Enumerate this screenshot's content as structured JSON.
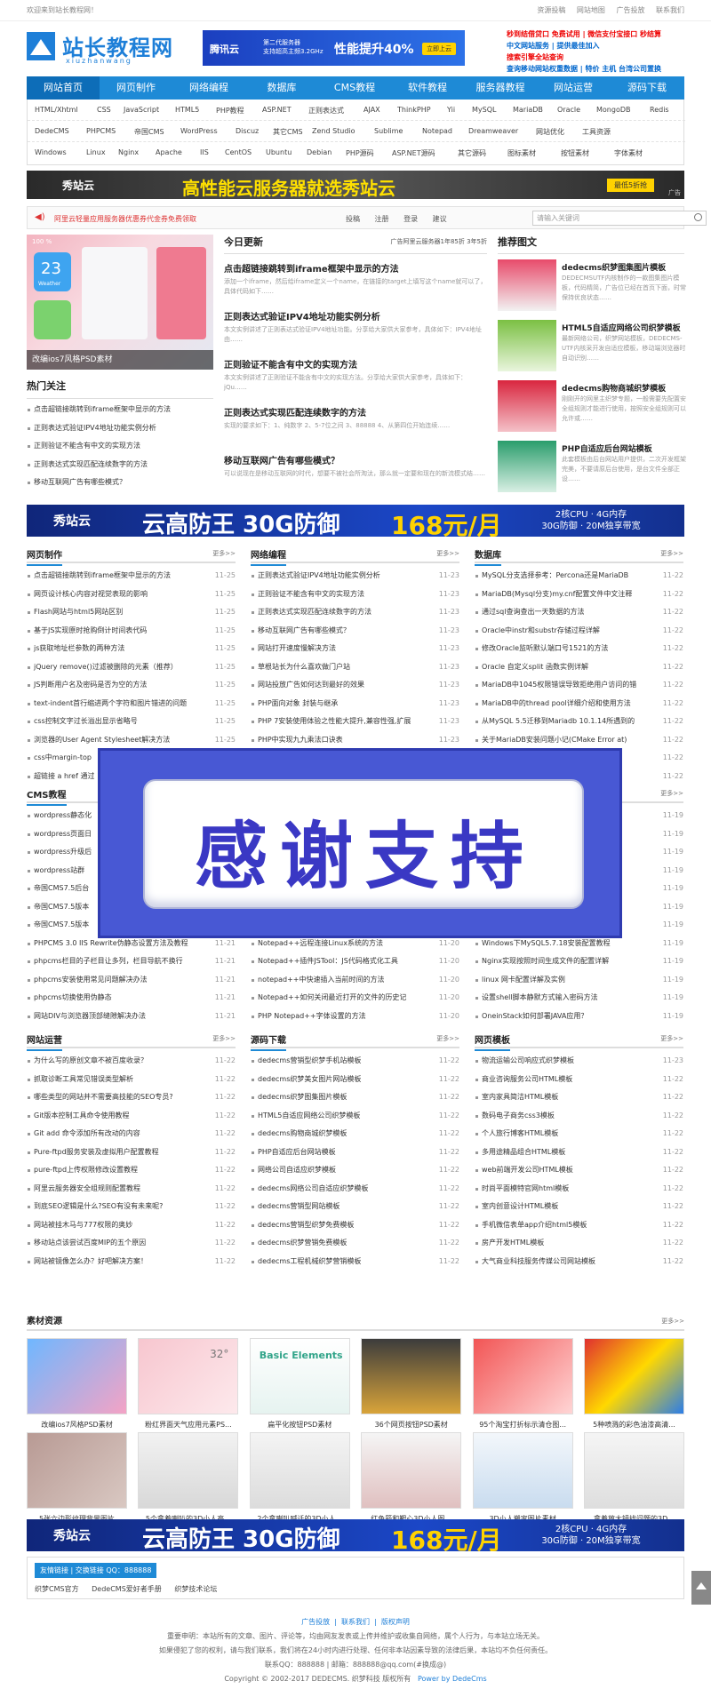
{
  "topbar": {
    "welcome": "欢迎来到站长教程网！",
    "links": [
      "资源投稿",
      "网站地图",
      "广告投放",
      "联系我们"
    ]
  },
  "logo": {
    "title": "站长教程网",
    "subtitle": "xiuzhanwang"
  },
  "ad_tencent": {
    "brand": "腾讯云",
    "line1": "第二代服务器",
    "line2": "支持超高主频3.2GHz",
    "promo": "性能提升40%",
    "button": "立即上云"
  },
  "ad_right": {
    "lines": [
      "秒到结借贷口 免费试用 | 微信支付宝接口 秒结算",
      "中文网站服务 | 提供最佳加入",
      "搜索引擎全站查询",
      "查询移动网站权重数据 | 特价 主机 台湾公司置换"
    ]
  },
  "nav": {
    "items": [
      "网站首页",
      "网页制作",
      "网络编程",
      "数据库",
      "CMS教程",
      "软件教程",
      "服务器教程",
      "网站运营",
      "源码下载"
    ]
  },
  "tags": [
    [
      "HTML/Xhtml",
      "CSS",
      "JavaScript",
      "HTML5",
      "PHP教程",
      "ASP.NET",
      "正则表达式",
      "AJAX",
      "ThinkPHP",
      "Yii",
      "MySQL",
      "MariaDB",
      "Oracle",
      "MongoDB",
      "Redis"
    ],
    [
      "DedeCMS",
      "PHPCMS",
      "帝国CMS",
      "WordPress",
      "Discuz",
      "其它CMS",
      "Zend Studio",
      "Sublime",
      "Notepad",
      "Dreamweaver",
      "网站优化",
      "工具资源"
    ],
    [
      "Windows",
      "Linux",
      "Nginx",
      "Apache",
      "IIS",
      "CentOS",
      "Ubuntu",
      "Debian",
      "PHP源码",
      "ASP.NET源码",
      "其它源码",
      "图标素材",
      "按钮素材",
      "字体素材"
    ]
  ],
  "banner_xiuzhanyun": {
    "brand": "秀站云",
    "slogan": "高性能云服务器就选秀站云",
    "button": "最低5折抢",
    "corner": "广告"
  },
  "notice": {
    "text": "阿里云轻量应用服务器优惠券代金券免费领取",
    "actions": [
      "投稿",
      "注册",
      "登录",
      "建议"
    ],
    "search_placeholder": "请输入关键词"
  },
  "feature": {
    "caption": "改编ios7风格PSD素材",
    "tile_num": "23",
    "tile_label": "Weather",
    "time": "100 %"
  },
  "hot": {
    "title": "热门关注",
    "items": [
      "点击超链接跳转到iframe框架中显示的方法",
      "正则表达式验证IPV4地址功能实例分析",
      "正则验证不能含有中文的实现方法",
      "正则表达式实现匹配连续数字的方法",
      "移动互联网广告有哪些模式？"
    ]
  },
  "today": {
    "title": "今日更新",
    "meta": "广告阿里云服务器1年85折 3年5折",
    "items": [
      {
        "title": "点击超链接跳转到iframe框架中显示的方法",
        "desc": "添加一个iframe，然后给iframe定义一个name，在链接的target上填写这个name就可以了，具体代码如下……"
      },
      {
        "title": "正则表达式验证IPV4地址功能实例分析",
        "desc": "本文实例讲述了正则表达式验证IPV4地址功能。分享给大家供大家参考，具体如下：IPV4地址由……"
      },
      {
        "title": "正则验证不能含有中文的实现方法",
        "desc": "本文实例讲述了正则验证不能含有中文的实现方法。分享给大家供大家参考，具体如下：jQu……"
      },
      {
        "title": "正则表达式实现匹配连续数字的方法",
        "desc": "实现的要求如下：1、纯数字 2、5-7位之间 3、88888 4、从第四位开始连续……"
      },
      {
        "title": "移动互联网广告有哪些模式？",
        "desc": "可以说现在是移动互联网的时代，想要不被社会所淘汰，那么就一定要和现在的新流模式结……"
      }
    ]
  },
  "recommend": {
    "title": "推荐图文",
    "items": [
      {
        "title": "dedecms织梦图集图片模板",
        "desc": "DEDECMSUTF内核制作的一款图集图片模板，代码精简，广告位已经在首页下面，时常保持优良状态……"
      },
      {
        "title": "HTML5自适应网络公司织梦模板",
        "desc": "最新网络公司，织梦网站模板，DEDECMS-UTF内核采开发自适应模板，移动端浏览器时自动识别……"
      },
      {
        "title": "dedecms购物商城织梦模板",
        "desc": "刚刚开的网里主织梦专题，一般需要先配置安全组规则才能进行使用，按照安全组规则可以允许或……"
      },
      {
        "title": "PHP自适应后台网站模板",
        "desc": "此套模板由后台网站用户提供，二次开发框架完美，不要请原后台使用，是台文件全部正设……"
      }
    ]
  },
  "banner_gaofang": {
    "brand": "秀站云",
    "title": "云高防王 30G防御",
    "price": "168元/月",
    "right1": "2核CPU · 4G内存",
    "right2": "30G防御 · 20M独享带宽"
  },
  "columns_row1": [
    {
      "title": "网页制作",
      "more": "更多>>",
      "items": [
        [
          "点击超链接跳转到iframe框架中显示的方法",
          "11-25"
        ],
        [
          "网页设计核心内容对视觉表现的影响",
          "11-25"
        ],
        [
          "Flash网站与html5网站区别",
          "11-25"
        ],
        [
          "基于JS实现原时抢购倒计时间表代码",
          "11-25"
        ],
        [
          "js获取地址栏参数的两种方法",
          "11-25"
        ],
        [
          "jQuery remove()过滤被删除的元素（推荐）",
          "11-25"
        ],
        [
          "JS判断用户名及密码是否为空的方法",
          "11-25"
        ],
        [
          "text-indent首行缩进两个字符和图片错进的问题",
          "11-25"
        ],
        [
          "css控制文字过长溢出显示省略号",
          "11-25"
        ],
        [
          "浏览器的User Agent Stylesheet解决方法",
          "11-25"
        ],
        [
          "css中margin-top",
          "11-25"
        ],
        [
          "超链接 a href 通过",
          "11-25"
        ]
      ]
    },
    {
      "title": "网络编程",
      "more": "更多>>",
      "items": [
        [
          "正则表达式验证IPV4地址功能实例分析",
          "11-23"
        ],
        [
          "正则验证不能含有中文的实现方法",
          "11-23"
        ],
        [
          "正则表达式实现匹配连续数字的方法",
          "11-23"
        ],
        [
          "移动互联网广告有哪些模式？",
          "11-23"
        ],
        [
          "网站打开速度慢解决方法",
          "11-23"
        ],
        [
          "草根站长为什么喜欢做门户站",
          "11-23"
        ],
        [
          "网站投放广告如何达到最好的效果",
          "11-23"
        ],
        [
          "PHP面向对象 封装与继承",
          "11-23"
        ],
        [
          "PHP 7安装使用体验之性能大提升,兼容性强,扩展",
          "11-23"
        ],
        [
          "PHP中实现九九乘法口诀表",
          "11-23"
        ],
        [
          "",
          "11-23"
        ],
        [
          "",
          "11-23"
        ]
      ]
    },
    {
      "title": "数据库",
      "more": "更多>>",
      "items": [
        [
          "MySQL分支选择参考：Percona还是MariaDB",
          "11-22"
        ],
        [
          "MariaDB(Mysql分支)my.cnf配置文件中文注释",
          "11-22"
        ],
        [
          "通过sql查询查出一天数据的方法",
          "11-22"
        ],
        [
          "Oracle中instr和substr存储过程详解",
          "11-22"
        ],
        [
          "修改Oracle监听默认端口号1521的方法",
          "11-22"
        ],
        [
          "Oracle 自定义split 函数实例详解",
          "11-22"
        ],
        [
          "MariaDB中1045权限错误导致拒绝用户访问的错",
          "11-22"
        ],
        [
          "MariaDB中的thread pool详细介绍和使用方法",
          "11-22"
        ],
        [
          "从MySQL 5.5迁移到Mariadb 10.1.14所遇到的",
          "11-22"
        ],
        [
          "关于MariaDB安装问题小记(CMake Error at)",
          "11-22"
        ],
        [
          "",
          "11-22"
        ],
        [
          "ry详解",
          "11-22"
        ]
      ]
    }
  ],
  "columns_row2": [
    {
      "title": "CMS教程",
      "more": "更多>>",
      "items": [
        [
          "wordpress静态化",
          "11-21"
        ],
        [
          "wordpress页面日",
          "11-21"
        ],
        [
          "wordpress升级后",
          "11-21"
        ],
        [
          "wordpress站群",
          "11-21"
        ],
        [
          "帝国CMS7.5后台",
          "11-21"
        ],
        [
          "帝国CMS7.5版本",
          "11-21"
        ],
        [
          "帝国CMS7.5版本",
          "11-21"
        ],
        [
          "PHPCMS 3.0 IIS Rewrite伪静态设置方法及教程",
          "11-21"
        ],
        [
          "phpcms栏目的子栏目让多列，栏目导航不换行",
          "11-21"
        ],
        [
          "phpcms安装使用常见问题解决办法",
          "11-21"
        ],
        [
          "phpcms切换使用伪静态",
          "11-21"
        ],
        [
          "网站DIV与浏览器顶部缝隙解决办法",
          "11-21"
        ]
      ]
    },
    {
      "title": "软件教程",
      "more": "更多>>",
      "items": [
        [
          "",
          "11-20"
        ],
        [
          "",
          "11-20"
        ],
        [
          "",
          "11-20"
        ],
        [
          "",
          "11-20"
        ],
        [
          "",
          "11-20"
        ],
        [
          "",
          "11-20"
        ],
        [
          "",
          "11-20"
        ],
        [
          "Notepad++远程连接Linux系统的方法",
          "11-20"
        ],
        [
          "Notepad++插件JSTool：JS代码格式化工具",
          "11-20"
        ],
        [
          "notepad++中快速插入当前时间的方法",
          "11-20"
        ],
        [
          "Notepad++如何关闭最近打开的文件的历史记",
          "11-20"
        ],
        [
          "PHP Notepad++字体设置的方法",
          "11-20"
        ]
      ]
    },
    {
      "title": "服务器教程",
      "more": "更多>>",
      "items": [
        [
          "",
          "11-19"
        ],
        [
          "",
          "11-19"
        ],
        [
          "",
          "11-19"
        ],
        [
          "",
          "11-19"
        ],
        [
          "",
          "11-19"
        ],
        [
          "",
          "11-19"
        ],
        [
          "的解决方",
          "11-19"
        ],
        [
          "Windows下MySQL5.7.18安装配置教程",
          "11-19"
        ],
        [
          "Nginx实现按照时间生成文件的配置详解",
          "11-19"
        ],
        [
          "linux 网卡配置详解及实例",
          "11-19"
        ],
        [
          "设置shell脚本静默方式输入密码方法",
          "11-19"
        ],
        [
          "OneinStack如何部署JAVA应用？",
          "11-19"
        ]
      ]
    }
  ],
  "columns_row3": [
    {
      "title": "网站运营",
      "more": "更多>>",
      "items": [
        [
          "为什么写的原创文章不被百度收录？",
          "11-22"
        ],
        [
          "抓取诊断工具常见错误类型解析",
          "11-22"
        ],
        [
          "哪些类型的网站并不需要高技能的SEO专员?",
          "11-22"
        ],
        [
          "Git版本控制工具命令使用教程",
          "11-22"
        ],
        [
          "Git add 命令添加所有改动的内容",
          "11-22"
        ],
        [
          "Pure-ftpd服务安装及虚拟用户配置教程",
          "11-22"
        ],
        [
          "pure-ftpd上传权限修改设置教程",
          "11-22"
        ],
        [
          "阿里云服务器安全组规则配置教程",
          "11-22"
        ],
        [
          "到底SEO逻辑是什么?SEO有没有未来呢?",
          "11-22"
        ],
        [
          "网站被挂木马与777权限的奥妙",
          "11-22"
        ],
        [
          "移动站点该尝试百度MIP的五个原因",
          "11-22"
        ],
        [
          "网站被镜像怎么办？好吧解决方案！",
          "11-22"
        ]
      ]
    },
    {
      "title": "源码下载",
      "more": "更多>>",
      "items": [
        [
          "dedecms营销型织梦手机站模板",
          "11-22"
        ],
        [
          "dedecms织梦美女图片网站模板",
          "11-22"
        ],
        [
          "dedecms织梦图集图片模板",
          "11-22"
        ],
        [
          "HTML5自适应网络公司织梦模板",
          "11-22"
        ],
        [
          "dedecms购物商城织梦模板",
          "11-22"
        ],
        [
          "PHP自适应后台网站模板",
          "11-22"
        ],
        [
          "网络公司自适应织梦模板",
          "11-22"
        ],
        [
          "dedecms网络公司自适应织梦模板",
          "11-22"
        ],
        [
          "dedecms营销型网站模板",
          "11-22"
        ],
        [
          "dedecms营销型织梦免费模板",
          "11-22"
        ],
        [
          "dedecms织梦营销免费模板",
          "11-22"
        ],
        [
          "dedecms工程机械织梦营销模板",
          "11-22"
        ]
      ]
    },
    {
      "title": "网页模板",
      "more": "更多>>",
      "items": [
        [
          "物流运输公司响应式织梦模板",
          "11-23"
        ],
        [
          "商业咨询服务公司HTML模板",
          "11-22"
        ],
        [
          "室内家具简洁HTML模板",
          "11-22"
        ],
        [
          "数码电子商务css3模板",
          "11-22"
        ],
        [
          "个人旅行博客HTML模板",
          "11-22"
        ],
        [
          "多用途精品组合HTML模板",
          "11-22"
        ],
        [
          "web前端开发公司HTML模板",
          "11-22"
        ],
        [
          "时尚平面模特官网html模板",
          "11-22"
        ],
        [
          "室内创意设计HTML模板",
          "11-22"
        ],
        [
          "手机微信表单app介绍html5模板",
          "11-22"
        ],
        [
          "房产开发HTML模板",
          "11-22"
        ],
        [
          "大气商业科技服务传媒公司网站模板",
          "11-22"
        ]
      ]
    }
  ],
  "materials": {
    "title": "素材资源",
    "more": "更多>>",
    "items": [
      "改编ios7风格PSD素材",
      "粉红界面天气应用元素PS...",
      "扁平化按钮PSD素材",
      "36个网页按钮PSD素材",
      "95个淘宝打折标示清仓图...",
      "5种喷溅的彩色油漆高清...",
      "5张六边形纹理背景图片",
      "5个拿着喇叭的3D小人高...",
      "2个拿喇叭喊话的3D小人...",
      "红色箭和靶心3D小人图...",
      "3D小人搬家图片素材",
      "拿着放大镜找问题的3D..."
    ],
    "basic_elements": "Basic Elements",
    "temp": "32°"
  },
  "thanks": {
    "text": "感谢支持"
  },
  "friend": {
    "tag": "友情链接 | 交换链接 QQ：888888",
    "links": [
      "织梦CMS官方",
      "DedeCMS爱好者手册",
      "织梦技术论坛"
    ]
  },
  "footer": {
    "links": [
      "广告投放",
      "联系我们",
      "版权声明"
    ],
    "line1": "重要申明：本站所有的文章、图片、评论等，均由网友发表或上传并维护或收集自网络，属个人行为，与本站立场无关。",
    "line2": "如果侵犯了您的权利，请与我们联系，我们将在24小时内进行处理、任何非本站因素导致的法律后果，本站均不负任何责任。",
    "line3": "联系QQ：888888 | 邮箱：888888@qq.com(#换成@)",
    "line4": "Copyright © 2002-2017 DEDECMS. 织梦科技 版权所有",
    "powered": "Power by DedeCms"
  },
  "colors": {
    "brand": "#1e8ad6",
    "dark_brand": "#0d6db8",
    "alert": "#dd3333"
  }
}
